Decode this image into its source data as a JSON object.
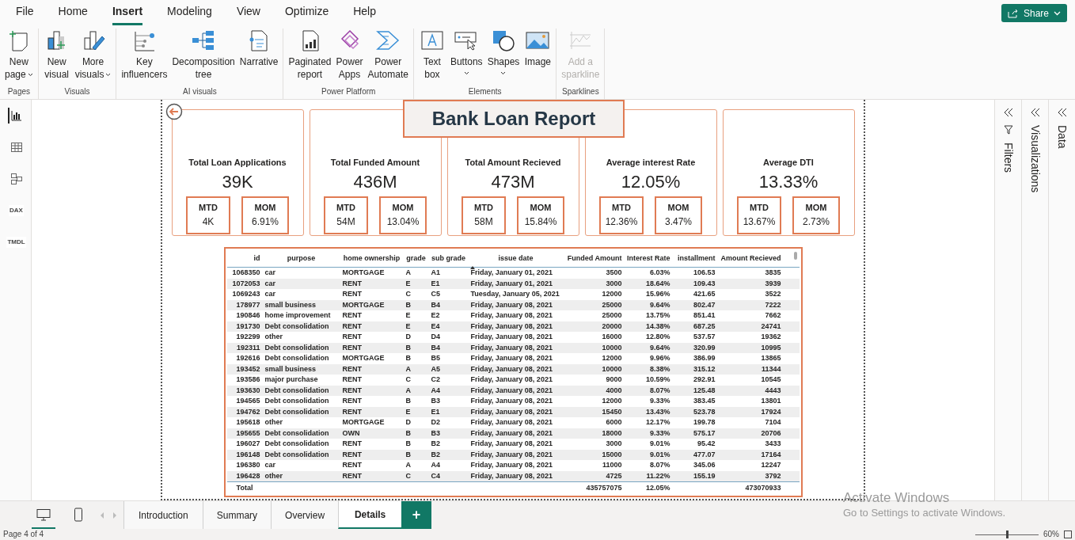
{
  "menu_tabs": [
    {
      "label": "File",
      "selected": false
    },
    {
      "label": "Home",
      "selected": false
    },
    {
      "label": "Insert",
      "selected": true
    },
    {
      "label": "Modeling",
      "selected": false
    },
    {
      "label": "View",
      "selected": false
    },
    {
      "label": "Optimize",
      "selected": false
    },
    {
      "label": "Help",
      "selected": false
    }
  ],
  "share_button": {
    "label": "Share"
  },
  "ribbon_groups": [
    {
      "label": "Pages",
      "items": [
        {
          "kind": "new-page",
          "lines": [
            "New",
            "page"
          ],
          "dropdown": true,
          "disabled": false
        }
      ]
    },
    {
      "label": "Visuals",
      "items": [
        {
          "kind": "new-visual",
          "lines": [
            "New",
            "visual"
          ],
          "dropdown": false,
          "disabled": false
        },
        {
          "kind": "more-visuals",
          "lines": [
            "More",
            "visuals"
          ],
          "dropdown": true,
          "disabled": false
        }
      ]
    },
    {
      "label": "AI visuals",
      "items": [
        {
          "kind": "key-influencers",
          "lines": [
            "Key",
            "influencers"
          ],
          "dropdown": false,
          "disabled": false
        },
        {
          "kind": "decomposition",
          "lines": [
            "Decomposition",
            "tree"
          ],
          "dropdown": false,
          "disabled": false
        },
        {
          "kind": "narrative",
          "lines": [
            "Narrative"
          ],
          "dropdown": false,
          "disabled": false
        }
      ]
    },
    {
      "label": "Power Platform",
      "items": [
        {
          "kind": "paginated",
          "lines": [
            "Paginated",
            "report"
          ],
          "dropdown": false,
          "disabled": false
        },
        {
          "kind": "power-apps",
          "lines": [
            "Power",
            "Apps"
          ],
          "dropdown": false,
          "disabled": false
        },
        {
          "kind": "power-automate",
          "lines": [
            "Power",
            "Automate"
          ],
          "dropdown": false,
          "disabled": false
        }
      ]
    },
    {
      "label": "Elements",
      "items": [
        {
          "kind": "text-box",
          "lines": [
            "Text",
            "box"
          ],
          "dropdown": false,
          "disabled": false
        },
        {
          "kind": "buttons",
          "lines": [
            "Buttons"
          ],
          "dropdown": true,
          "disabled": false
        },
        {
          "kind": "shapes",
          "lines": [
            "Shapes"
          ],
          "dropdown": true,
          "disabled": false
        },
        {
          "kind": "image",
          "lines": [
            "Image"
          ],
          "dropdown": false,
          "disabled": false
        }
      ]
    },
    {
      "label": "Sparklines",
      "items": [
        {
          "kind": "sparkline",
          "lines": [
            "Add a",
            "sparkline"
          ],
          "dropdown": false,
          "disabled": true
        }
      ]
    }
  ],
  "left_rail": [
    {
      "kind": "report",
      "selected": true
    },
    {
      "kind": "table",
      "selected": false
    },
    {
      "kind": "model",
      "selected": false
    },
    {
      "kind": "dax",
      "label": "DAX",
      "selected": false
    },
    {
      "kind": "tmdl",
      "label": "TMDL",
      "selected": false
    }
  ],
  "report": {
    "title": "Bank Loan Report",
    "kpis": [
      {
        "title": "Total Loan Applications",
        "value": "39K",
        "mtd_label": "MTD",
        "mtd": "4K",
        "mom_label": "MOM",
        "mom": "6.91%"
      },
      {
        "title": "Total Funded Amount",
        "value": "436M",
        "mtd_label": "MTD",
        "mtd": "54M",
        "mom_label": "MOM",
        "mom": "13.04%"
      },
      {
        "title": "Total Amount Recieved",
        "value": "473M",
        "mtd_label": "MTD",
        "mtd": "58M",
        "mom_label": "MOM",
        "mom": "15.84%"
      },
      {
        "title": "Average interest Rate",
        "value": "12.05%",
        "mtd_label": "MTD",
        "mtd": "12.36%",
        "mom_label": "MOM",
        "mom": "3.47%"
      },
      {
        "title": "Average DTI",
        "value": "13.33%",
        "mtd_label": "MTD",
        "mtd": "13.67%",
        "mom_label": "MOM",
        "mom": "2.73%"
      }
    ],
    "table": {
      "columns": [
        {
          "label": "id",
          "kind": "number",
          "sorted": false,
          "total": "Total"
        },
        {
          "label": "purpose",
          "kind": "text",
          "sorted": false
        },
        {
          "label": "home ownership",
          "kind": "text",
          "sorted": false
        },
        {
          "label": "grade",
          "kind": "text",
          "sorted": false
        },
        {
          "label": "sub grade",
          "kind": "text",
          "sorted": false
        },
        {
          "label": "issue date",
          "kind": "text",
          "sorted": true
        },
        {
          "label": "Funded Amount",
          "kind": "number",
          "sorted": false,
          "total": "435757075"
        },
        {
          "label": "Interest Rate",
          "kind": "number",
          "sorted": false,
          "total": "12.05%"
        },
        {
          "label": "installment",
          "kind": "number",
          "sorted": false
        },
        {
          "label": "Amount Recieved",
          "kind": "number",
          "sorted": false,
          "total": "473070933"
        }
      ],
      "rows": [
        [
          "1068350",
          "car",
          "MORTGAGE",
          "A",
          "A1",
          "Friday, January 01, 2021",
          "3500",
          "6.03%",
          "106.53",
          "3835"
        ],
        [
          "1072053",
          "car",
          "RENT",
          "E",
          "E1",
          "Friday, January 01, 2021",
          "3000",
          "18.64%",
          "109.43",
          "3939"
        ],
        [
          "1069243",
          "car",
          "RENT",
          "C",
          "C5",
          "Tuesday, January 05, 2021",
          "12000",
          "15.96%",
          "421.65",
          "3522"
        ],
        [
          "178977",
          "small business",
          "MORTGAGE",
          "B",
          "B4",
          "Friday, January 08, 2021",
          "25000",
          "9.64%",
          "802.47",
          "7222"
        ],
        [
          "190846",
          "home improvement",
          "RENT",
          "E",
          "E2",
          "Friday, January 08, 2021",
          "25000",
          "13.75%",
          "851.41",
          "7662"
        ],
        [
          "191730",
          "Debt consolidation",
          "RENT",
          "E",
          "E4",
          "Friday, January 08, 2021",
          "20000",
          "14.38%",
          "687.25",
          "24741"
        ],
        [
          "192299",
          "other",
          "RENT",
          "D",
          "D4",
          "Friday, January 08, 2021",
          "16000",
          "12.80%",
          "537.57",
          "19362"
        ],
        [
          "192311",
          "Debt consolidation",
          "RENT",
          "B",
          "B4",
          "Friday, January 08, 2021",
          "10000",
          "9.64%",
          "320.99",
          "10995"
        ],
        [
          "192616",
          "Debt consolidation",
          "MORTGAGE",
          "B",
          "B5",
          "Friday, January 08, 2021",
          "12000",
          "9.96%",
          "386.99",
          "13865"
        ],
        [
          "193452",
          "small business",
          "RENT",
          "A",
          "A5",
          "Friday, January 08, 2021",
          "10000",
          "8.38%",
          "315.12",
          "11344"
        ],
        [
          "193586",
          "major purchase",
          "RENT",
          "C",
          "C2",
          "Friday, January 08, 2021",
          "9000",
          "10.59%",
          "292.91",
          "10545"
        ],
        [
          "193630",
          "Debt consolidation",
          "RENT",
          "A",
          "A4",
          "Friday, January 08, 2021",
          "4000",
          "8.07%",
          "125.48",
          "4443"
        ],
        [
          "194565",
          "Debt consolidation",
          "RENT",
          "B",
          "B3",
          "Friday, January 08, 2021",
          "12000",
          "9.33%",
          "383.45",
          "13801"
        ],
        [
          "194762",
          "Debt consolidation",
          "RENT",
          "E",
          "E1",
          "Friday, January 08, 2021",
          "15450",
          "13.43%",
          "523.78",
          "17924"
        ],
        [
          "195618",
          "other",
          "MORTGAGE",
          "D",
          "D2",
          "Friday, January 08, 2021",
          "6000",
          "12.17%",
          "199.78",
          "7104"
        ],
        [
          "195655",
          "Debt consolidation",
          "OWN",
          "B",
          "B3",
          "Friday, January 08, 2021",
          "18000",
          "9.33%",
          "575.17",
          "20706"
        ],
        [
          "196027",
          "Debt consolidation",
          "RENT",
          "B",
          "B2",
          "Friday, January 08, 2021",
          "3000",
          "9.01%",
          "95.42",
          "3433"
        ],
        [
          "196148",
          "Debt consolidation",
          "RENT",
          "B",
          "B2",
          "Friday, January 08, 2021",
          "15000",
          "9.01%",
          "477.07",
          "17164"
        ],
        [
          "196380",
          "car",
          "RENT",
          "A",
          "A4",
          "Friday, January 08, 2021",
          "11000",
          "8.07%",
          "345.06",
          "12247"
        ],
        [
          "196428",
          "other",
          "RENT",
          "C",
          "C4",
          "Friday, January 08, 2021",
          "4725",
          "11.22%",
          "155.19",
          "3792"
        ]
      ]
    }
  },
  "side_panes": [
    {
      "kind": "filters",
      "label": "Filters"
    },
    {
      "kind": "plain",
      "label": "Visualizations"
    },
    {
      "kind": "plain",
      "label": "Data"
    }
  ],
  "view_buttons": [
    {
      "kind": "desktop",
      "selected": true
    },
    {
      "kind": "phone",
      "selected": false
    }
  ],
  "page_tabs": [
    {
      "label": "Introduction",
      "selected": false
    },
    {
      "label": "Summary",
      "selected": false
    },
    {
      "label": "Overview",
      "selected": false
    },
    {
      "label": "Details",
      "selected": true
    }
  ],
  "add_page_button": {
    "label": "+"
  },
  "activation_notice": {
    "title": "Activate Windows",
    "text": "Go to Settings to activate Windows."
  },
  "status_bar": {
    "page": "Page 4 of 4",
    "zoom_slider": {
      "level": 0.5
    },
    "zoom": "60%"
  }
}
